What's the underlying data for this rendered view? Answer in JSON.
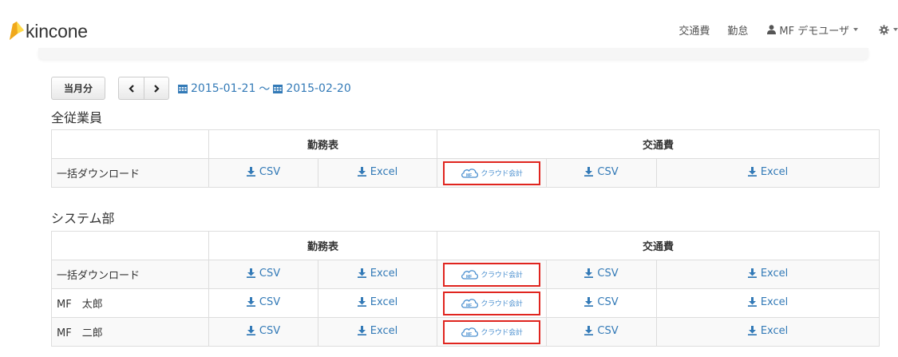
{
  "navbar": {
    "brand": "kincone",
    "links": [
      {
        "label": "交通費"
      },
      {
        "label": "勤怠"
      }
    ],
    "user_label": "MF デモユーザ",
    "user_icon": "user-icon",
    "settings_icon": "gear-icon"
  },
  "toolbar": {
    "month_button": "当月分",
    "prev_icon": "chevron-left-icon",
    "next_icon": "chevron-right-icon",
    "start_date": "2015-01-21",
    "separator": "～",
    "end_date": "2015-02-20"
  },
  "table_headers": {
    "attendance": "勤務表",
    "transport": "交通費"
  },
  "labels": {
    "csv": "CSV",
    "excel": "Excel",
    "mf_cloud": "クラウド会計",
    "mf_prefix": "MF"
  },
  "sections": [
    {
      "title": "全従業員",
      "rows": [
        {
          "name": "一括ダウンロード"
        }
      ]
    },
    {
      "title": "システム部",
      "rows": [
        {
          "name": "一括ダウンロード"
        },
        {
          "name": "MF　太郎"
        },
        {
          "name": "MF　二郎"
        }
      ]
    }
  ],
  "colors": {
    "link": "#337ab7",
    "highlight_border": "#e0251f",
    "brand_yellow": "#f5c518"
  }
}
